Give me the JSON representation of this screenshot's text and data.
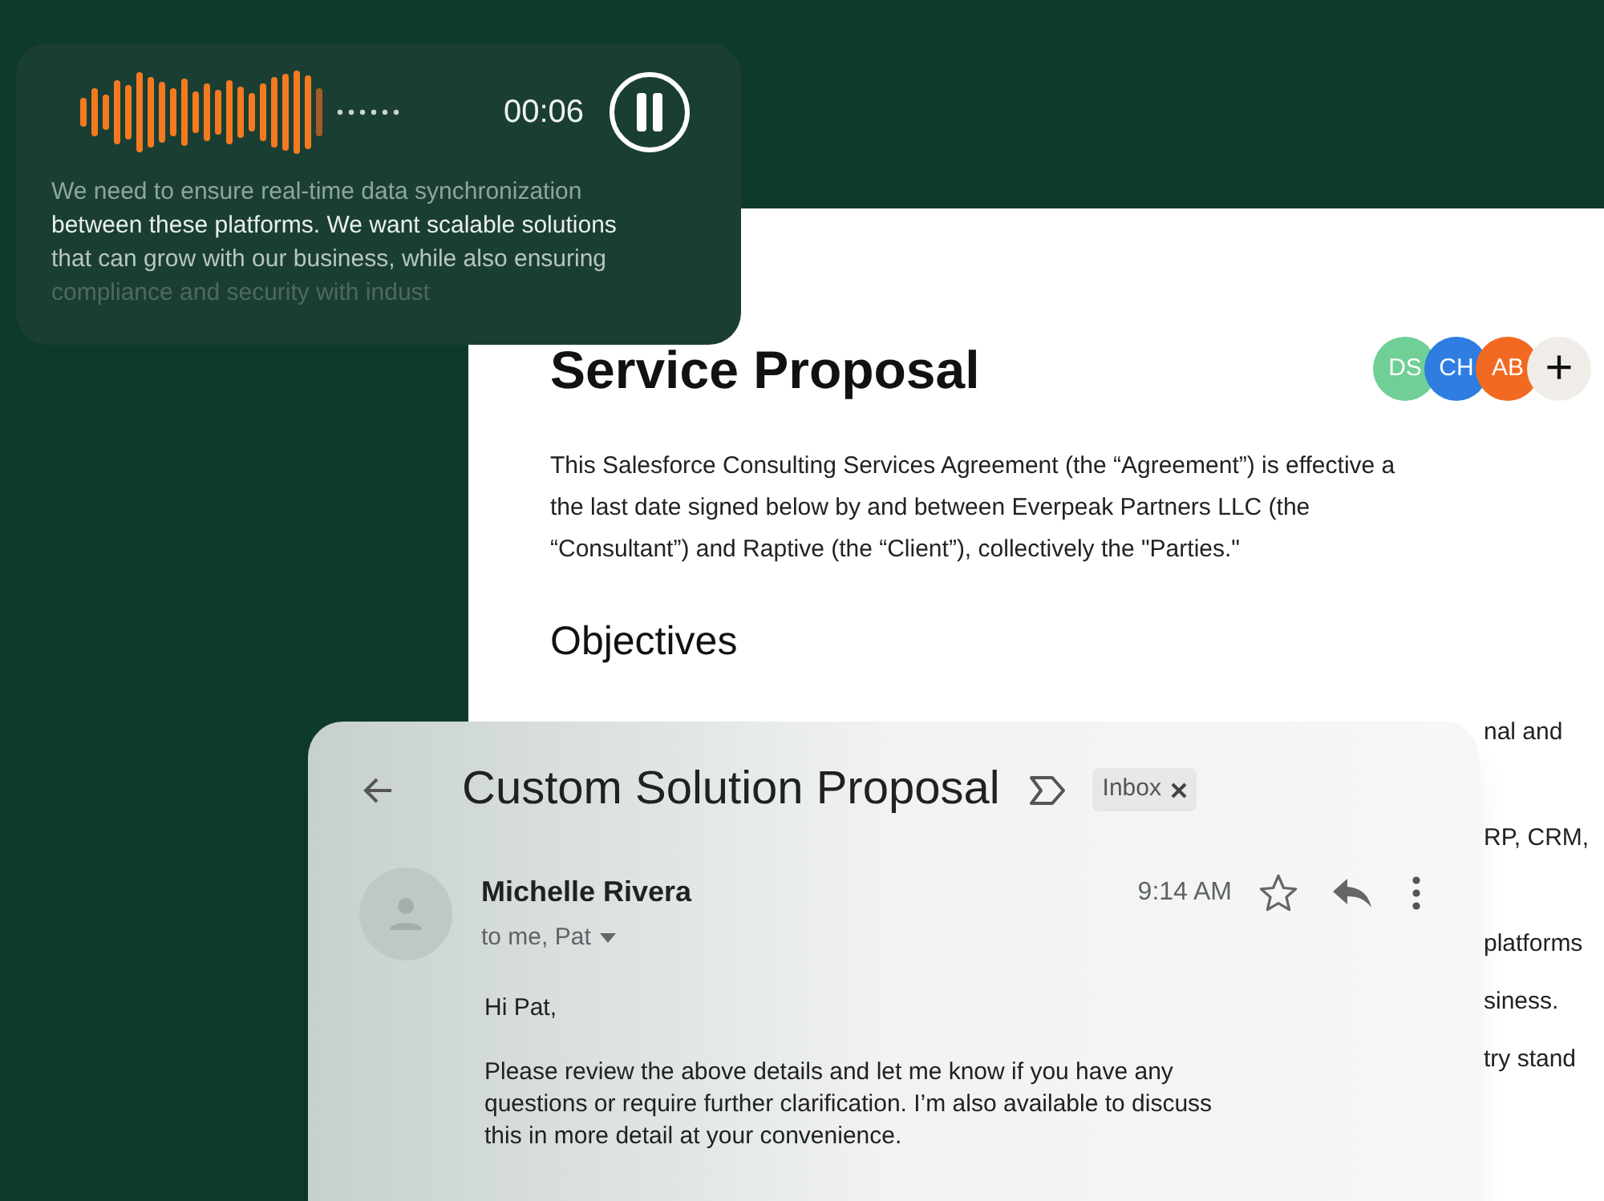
{
  "voice_note": {
    "time": "00:06",
    "playing": true,
    "transcript_lines": [
      "We need to ensure real-time data synchronization",
      "between these platforms. We want scalable solutions",
      "that can grow with our business, while also ensuring",
      "compliance and security with indust"
    ]
  },
  "document": {
    "title": "Service Proposal",
    "collaborators": [
      {
        "initials": "DS",
        "color": "#6fcf97"
      },
      {
        "initials": "CH",
        "color": "#2f7de1"
      },
      {
        "initials": "AB",
        "color": "#f26a21"
      }
    ],
    "add_label": "+",
    "intro_lines": [
      "This Salesforce Consulting Services Agreement (the “Agreement”) is effective a",
      "the last date signed below by and between Everpeak Partners LLC (the",
      "“Consultant”) and Raptive (the “Client”), collectively the \"Parties.\""
    ],
    "section_heading": "Objectives",
    "fragments": [
      "nal and",
      "RP, CRM,",
      "platforms",
      "siness.",
      "try stand"
    ]
  },
  "email": {
    "subject": "Custom Solution Proposal",
    "label": "Inbox",
    "sender": "Michelle Rivera",
    "recipients": "to me, Pat",
    "time": "9:14 AM",
    "starred": false,
    "greeting": "Hi Pat,",
    "body_lines": [
      "Please review the above details and let me know if you have any",
      "questions or require further clarification. I’m also available to discuss",
      "this in more detail at your convenience."
    ]
  }
}
